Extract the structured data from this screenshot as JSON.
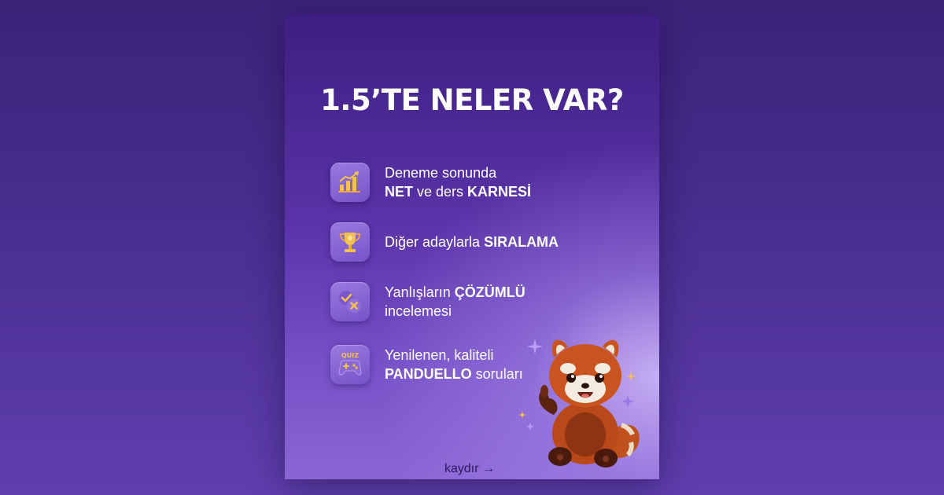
{
  "title": "1.5’TE NELER VAR?",
  "features": [
    {
      "icon": "bar-chart-icon",
      "line1": "Deneme sonunda",
      "line2_bold1": "NET",
      "line2_mid": " ve ders ",
      "line2_bold2": "KARNESİ"
    },
    {
      "icon": "trophy-icon",
      "text": "Diğer adaylarla ",
      "bold": "SIRALAMA"
    },
    {
      "icon": "check-cross-icon",
      "line1_text": "Yanlışların ",
      "line1_bold": "ÇÖZÜMLÜ",
      "line2": "incelemesi"
    },
    {
      "icon": "quiz-gamepad-icon",
      "icon_label": "QUIZ",
      "line1": "Yenilenen, kaliteli",
      "line2_bold": "PANDUELLO",
      "line2_rest": " soruları"
    }
  ],
  "scroll_hint": "kaydır →",
  "mascot": "red-panda-mascot",
  "colors": {
    "background": "#4b2f92",
    "card_top": "#3c1f80",
    "card_bottom": "#8a66d4",
    "icon_bg": "#8a6ad8",
    "icon_gold": "#f2c14e",
    "text": "#ffffff"
  }
}
